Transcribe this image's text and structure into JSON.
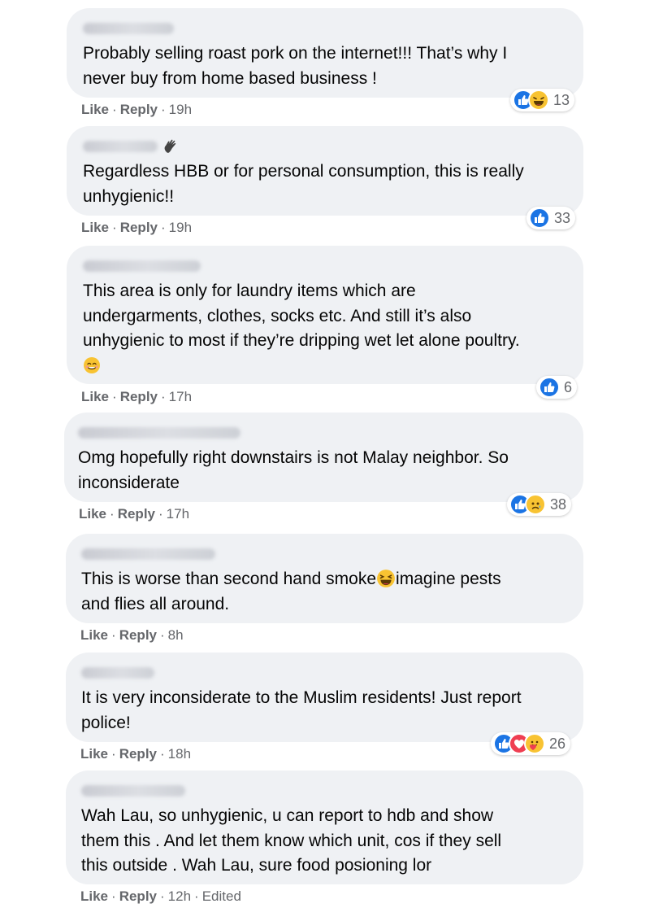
{
  "actions": {
    "like": "Like",
    "reply": "Reply",
    "dot": "·"
  },
  "comments": [
    {
      "text": "Probably selling roast pork on the internet!!! That’s why I\nnever buy from home based business !",
      "time": "19h",
      "reactions": [
        "like",
        "haha"
      ],
      "count": "13"
    },
    {
      "text": "Regardless HBB or for personal consumption, this is really\nunhygienic!!",
      "time": "19h",
      "reactions": [
        "like"
      ],
      "count": "33"
    },
    {
      "text": "This area is only for laundry items which are\nundergarments, clothes, socks etc. And still it’s also\nunhygienic to most if they’re dripping wet let alone poultry.",
      "time": "17h",
      "reactions": [
        "like"
      ],
      "count": "6"
    },
    {
      "text": "Omg hopefully right downstairs is not Malay neighbor. So\ninconsiderate",
      "time": "17h",
      "reactions": [
        "like",
        "sad"
      ],
      "count": "38"
    },
    {
      "text_before": "This is worse than second hand smoke",
      "text_after": "imagine pests\nand flies all around.",
      "time": "8h"
    },
    {
      "text": "It is very inconsiderate to the Muslim residents! Just report\npolice!",
      "time": "18h",
      "reactions": [
        "like",
        "love",
        "care"
      ],
      "count": "26"
    },
    {
      "text": "Wah Lau, so unhygienic, u can report to hdb and show\nthem this . And let them know which unit, cos if they sell\nthis outside . Wah Lau, sure food posioning lor",
      "time": "12h",
      "edited": "Edited"
    }
  ],
  "colors": {
    "bubble": "#eff1f4",
    "meta": "#65676b",
    "like_blue": "#1b74e4",
    "emoji_yellow": "#f8c332",
    "love_red": "#ef3e52"
  },
  "icons": {
    "like": "like-reaction-icon",
    "haha": "haha-reaction-icon",
    "sad": "sad-reaction-icon",
    "love": "love-reaction-icon",
    "care": "care-reaction-icon",
    "wave": "waving-hand-icon",
    "smile": "smiling-emoji",
    "laugh": "laughing-emoji"
  }
}
